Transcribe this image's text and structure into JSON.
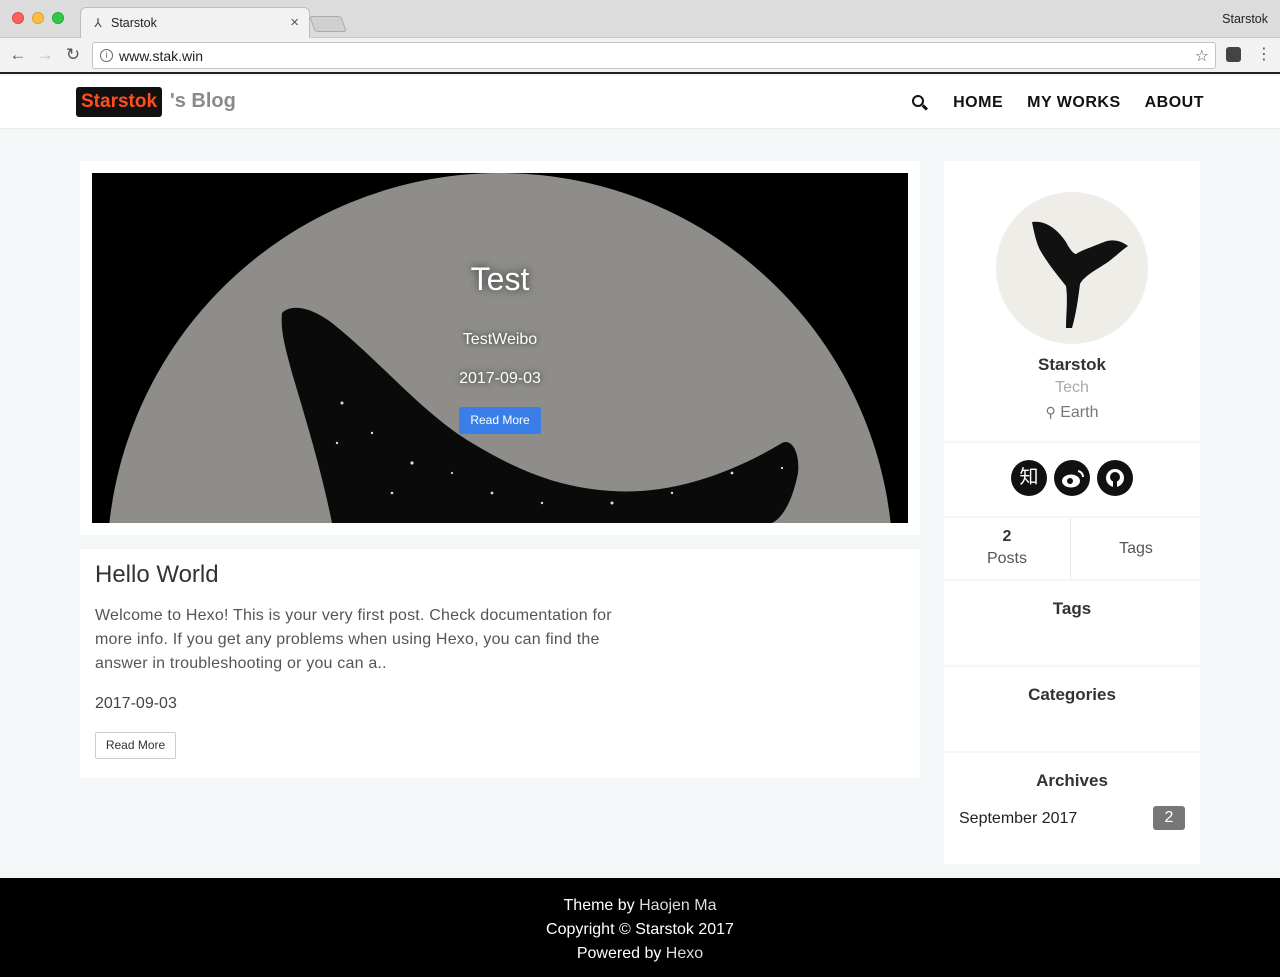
{
  "browser": {
    "tab_title": "Starstok",
    "tab_favicon": "whale-tail-icon",
    "tab_close": "×",
    "profile_name": "Starstok",
    "url": "www.stak.win"
  },
  "header": {
    "logo_badge": "Starstok",
    "logo_suffix": "'s Blog",
    "nav": [
      "HOME",
      "MY WORKS",
      "ABOUT"
    ],
    "accent_color": "#ff4d1f"
  },
  "hero": {
    "title": "Test",
    "subtitle": "TestWeibo",
    "date": "2017-09-03",
    "button": "Read More"
  },
  "post": {
    "title": "Hello World",
    "excerpt": "Welcome to Hexo! This is your very first post. Check documentation for more info. If you get any problems when using Hexo, you can find the answer in troubleshooting or you can a..",
    "date": "2017-09-03",
    "button": "Read More"
  },
  "profile": {
    "name": "Starstok",
    "role": "Tech",
    "location": "Earth",
    "socials": [
      {
        "icon": "zhihu-icon",
        "glyph": "知"
      },
      {
        "icon": "weibo-icon",
        "glyph": ""
      },
      {
        "icon": "github-icon",
        "glyph": ""
      }
    ]
  },
  "stats": {
    "posts_count": "2",
    "posts_label": "Posts",
    "tags_label": "Tags"
  },
  "widgets": {
    "tags_title": "Tags",
    "categories_title": "Categories",
    "archives_title": "Archives",
    "archives": [
      {
        "month": "September 2017",
        "count": "2"
      }
    ]
  },
  "footer": {
    "theme_prefix": "Theme by ",
    "theme_author": "Haojen Ma",
    "copyright": "Copyright © Starstok 2017",
    "powered_prefix": "Powered by ",
    "powered_name": "Hexo"
  }
}
